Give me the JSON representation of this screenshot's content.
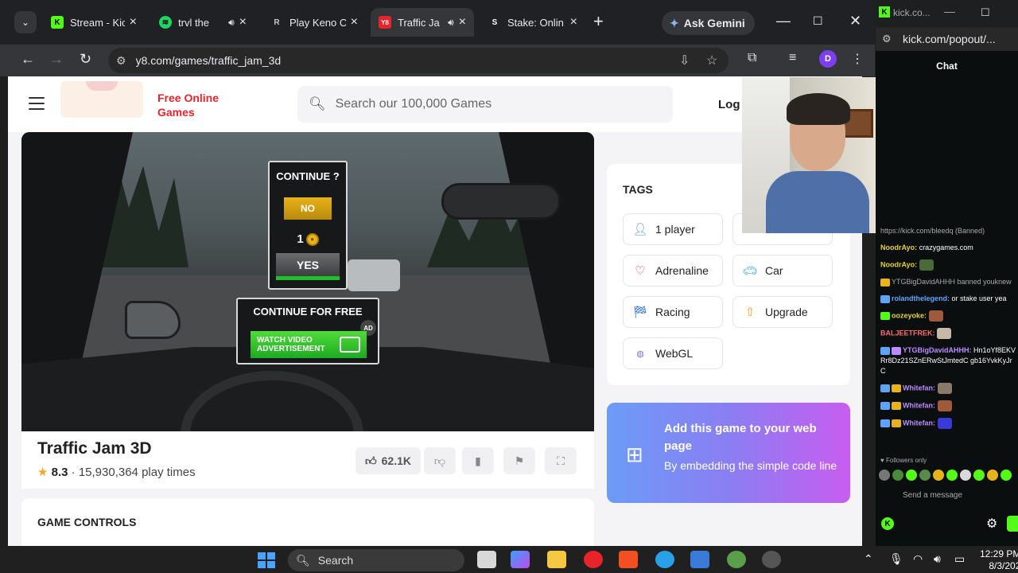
{
  "browser": {
    "tabs": [
      {
        "label": "Stream - Kic",
        "favicon": "kick-icon",
        "color": "#53fc18",
        "active": false
      },
      {
        "label": "trvl the",
        "favicon": "spotify-icon",
        "color": "#1ed760",
        "active": false,
        "audio": true
      },
      {
        "label": "Play Keno O",
        "favicon": "roobet-icon",
        "color": "#c4c7c5",
        "active": false
      },
      {
        "label": "Traffic Ja",
        "favicon": "y8-icon",
        "color": "#e8232a",
        "active": true,
        "audio": true
      },
      {
        "label": "Stake: Onlin",
        "favicon": "stake-icon",
        "color": "#ffffff",
        "active": false
      }
    ],
    "gemini_label": "Ask Gemini",
    "url": "y8.com/games/traffic_jam_3d",
    "profile_initial": "D"
  },
  "site": {
    "logo_line1": "Free Online",
    "logo_line2": "Games",
    "search_placeholder": "Search our 100,000 Games",
    "login_label": "Log"
  },
  "game_overlay": {
    "continue_title": "CONTINUE ?",
    "no_label": "NO",
    "cost": "1",
    "yes_label": "YES",
    "free_title": "CONTINUE FOR FREE",
    "ad_badge": "AD",
    "watch_line1": "WATCH VIDEO",
    "watch_line2": "ADVERTISEMENT"
  },
  "game_info": {
    "title": "Traffic Jam 3D",
    "rating": "8.3",
    "separator": "·",
    "plays": "15,930,364 play times",
    "likes": "62.1K"
  },
  "controls_title": "GAME CONTROLS",
  "tags": {
    "title": "TAGS",
    "items": [
      {
        "label": "1 player",
        "icon": "person-icon"
      },
      {
        "label": "Adrenaline",
        "icon": "heartbeat-icon"
      },
      {
        "label": "Car",
        "icon": "car-icon"
      },
      {
        "label": "Racing",
        "icon": "racing-flag-icon"
      },
      {
        "label": "Upgrade",
        "icon": "upgrade-arrow-icon"
      },
      {
        "label": "WebGL",
        "icon": "webgl-icon"
      }
    ]
  },
  "embed": {
    "title": "Add this game to your web page",
    "subtitle": "By embedding the simple code line"
  },
  "kick": {
    "window_title": "kick.co...",
    "url": "kick.com/popout/...",
    "chat_header": "Chat",
    "messages": [
      {
        "user": "",
        "text": "https://kick.com/bleedq (Banned)"
      },
      {
        "user": "NoodrAyo:",
        "text": "crazygames.com"
      },
      {
        "user": "NoodrAyo:",
        "text": ""
      },
      {
        "user": "YTGBigDavidAHHH",
        "text": "banned youknew"
      },
      {
        "user": "rolandthelegend:",
        "text": "or stake user yea"
      },
      {
        "user": "oozeyoke:",
        "text": ""
      },
      {
        "user": "BALJEETFREK:",
        "text": ""
      },
      {
        "user": "YTGBigDavidAHHH:",
        "text": "Hn1oYf8EKVRr8Dz21SZnERwStJmtedC gb16YvkKyJrC"
      },
      {
        "user": "Whitefan:",
        "text": ""
      },
      {
        "user": "Whitefan:",
        "text": ""
      },
      {
        "user": "Whitefan:",
        "text": ""
      }
    ],
    "followers_only": "Followers only",
    "send_placeholder": "Send a message"
  },
  "taskbar": {
    "search_label": "Search",
    "time": "12:29 PM",
    "date": "8/3/202"
  }
}
